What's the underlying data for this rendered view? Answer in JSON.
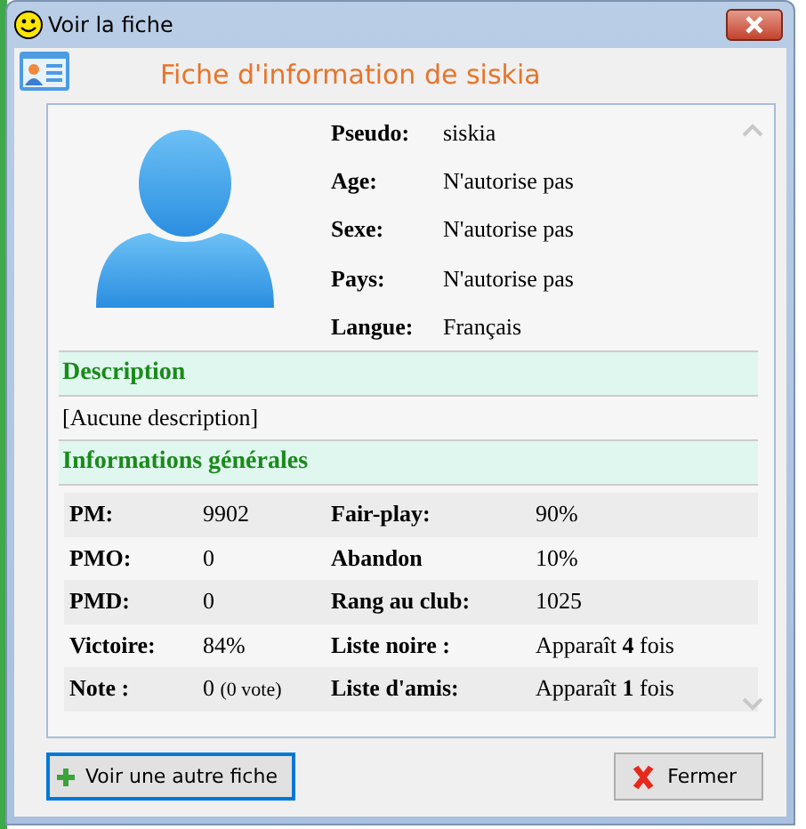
{
  "window": {
    "title": "Voir la fiche"
  },
  "header": "Fiche d'information de siskia",
  "profile": [
    {
      "label": "Pseudo:",
      "value": "siskia"
    },
    {
      "label": "Age:",
      "value": "N'autorise pas"
    },
    {
      "label": "Sexe:",
      "value": "N'autorise pas"
    },
    {
      "label": "Pays:",
      "value": "N'autorise pas"
    },
    {
      "label": "Langue:",
      "value": "Français"
    }
  ],
  "description": {
    "title": "Description",
    "text": "[Aucune description]"
  },
  "general": {
    "title": "Informations générales",
    "rows": [
      {
        "label_1": "PM:",
        "value_1": "9902",
        "label_2": "Fair-play:",
        "value_2": "90%"
      },
      {
        "label_1": "PMO:",
        "value_1": "0",
        "label_2": "Abandon",
        "value_2": "10%"
      },
      {
        "label_1": "PMD:",
        "value_1": "0",
        "label_2": "Rang au club:",
        "value_2": "1025"
      },
      {
        "label_1": "Victoire:",
        "value_1": "84%",
        "label_2": "Liste noire :",
        "value_2": "Apparaît **4** fois"
      },
      {
        "label_1": "Note :",
        "value_1": "0",
        "note_1": "(0 vote)",
        "label_2": "Liste d'amis:",
        "value_2": "Apparaît **1** fois"
      }
    ]
  },
  "buttons": [
    {
      "label": "Voir une autre fiche",
      "kind": "add",
      "selected": true
    },
    {
      "label": "Fermer",
      "kind": "close",
      "selected": false
    }
  ]
}
